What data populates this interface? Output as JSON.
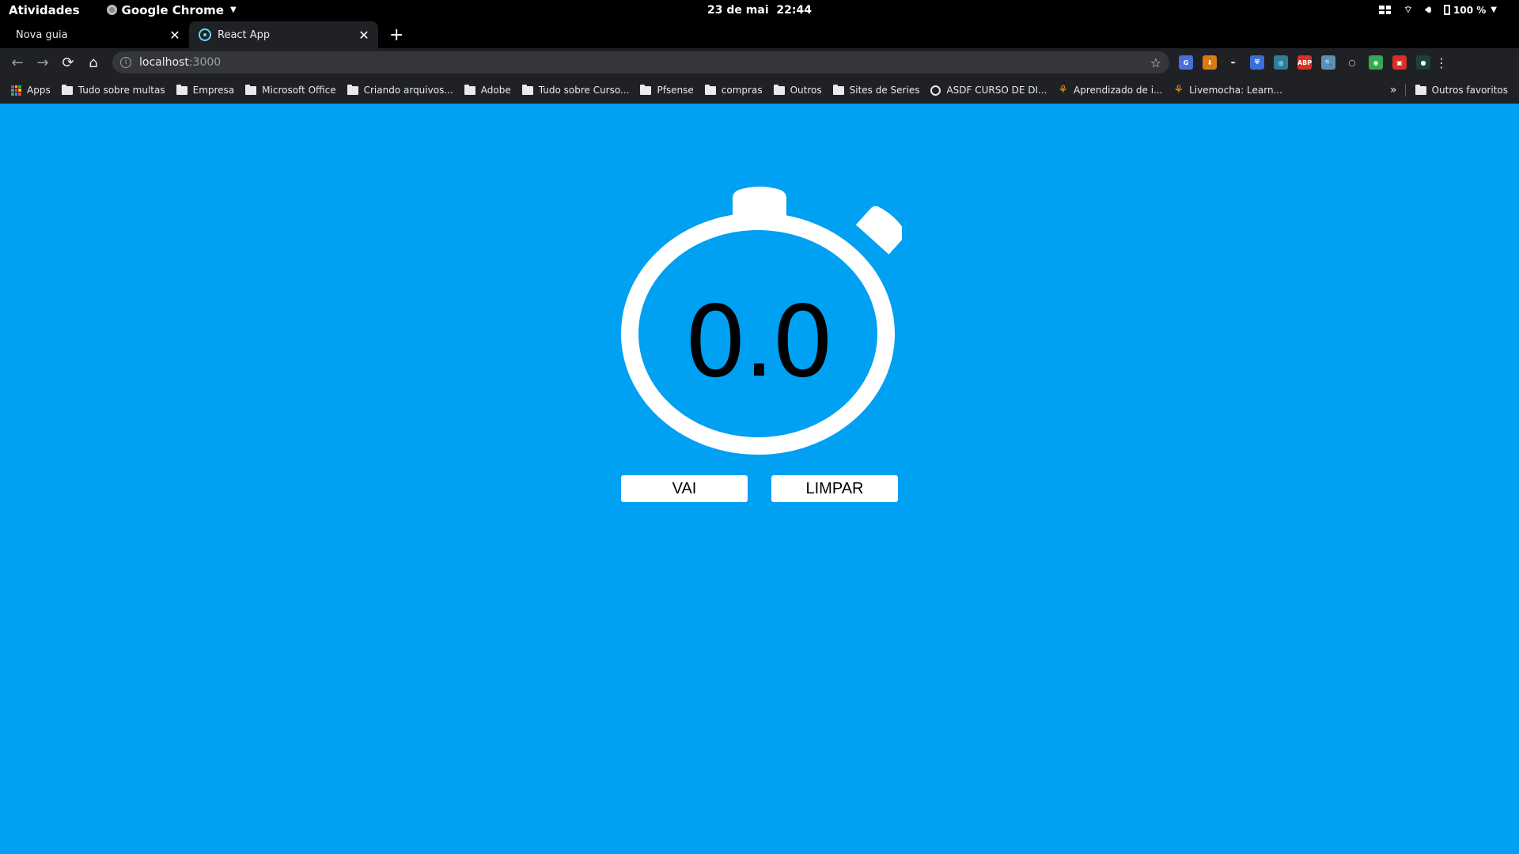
{
  "os": {
    "activities": "Atividades",
    "app_name": "Google Chrome",
    "date": "23 de mai",
    "time": "22:44",
    "battery": "100 %"
  },
  "tabs": [
    {
      "label": "Nova guia",
      "close": "✕",
      "active": false
    },
    {
      "label": "React App",
      "close": "✕",
      "active": true
    }
  ],
  "newtab_label": "+",
  "toolbar": {
    "back": "←",
    "forward": "→",
    "reload": "⟳",
    "home": "⌂",
    "url_host": "localhost",
    "url_port": ":3000",
    "star": "☆",
    "menu": "⋮"
  },
  "extensions": [
    {
      "name": "translate-extension-icon",
      "color": "#4a6ee0",
      "label": "G"
    },
    {
      "name": "download-extension-icon",
      "color": "#d97a15",
      "label": "⬇"
    },
    {
      "name": "feather-extension-icon",
      "color": "#202124",
      "label": "✒"
    },
    {
      "name": "shield-extension-icon",
      "color": "#3a6fd8",
      "label": "⛨"
    },
    {
      "name": "colorful-extension-icon",
      "color": "#2e7d9a",
      "label": "◎"
    },
    {
      "name": "adblock-extension-icon",
      "color": "#d93025",
      "label": "ABP"
    },
    {
      "name": "magnifier-extension-icon",
      "color": "#5e8fb3",
      "label": "🔍"
    },
    {
      "name": "circle-extension-icon",
      "color": "#202124",
      "label": "◯"
    },
    {
      "name": "chrome-extension-icon",
      "color": "#34a853",
      "label": "◉"
    },
    {
      "name": "red-extension-icon",
      "color": "#d93025",
      "label": "▣"
    },
    {
      "name": "profile-extension-icon",
      "color": "#1b4332",
      "label": "●"
    }
  ],
  "bookmarks": {
    "apps": "Apps",
    "items": [
      {
        "label": "Tudo sobre multas",
        "icon": "folder"
      },
      {
        "label": "Empresa",
        "icon": "folder"
      },
      {
        "label": "Microsoft Office",
        "icon": "folder"
      },
      {
        "label": "Criando arquivos...",
        "icon": "folder"
      },
      {
        "label": "Adobe",
        "icon": "folder"
      },
      {
        "label": "Tudo sobre Curso...",
        "icon": "folder"
      },
      {
        "label": "Pfsense",
        "icon": "folder"
      },
      {
        "label": "compras",
        "icon": "folder"
      },
      {
        "label": "Outros",
        "icon": "folder"
      },
      {
        "label": "Sites de Series",
        "icon": "folder"
      },
      {
        "label": "ASDF CURSO DE DI...",
        "icon": "globe"
      },
      {
        "label": "Aprendizado de i...",
        "icon": "lingo"
      },
      {
        "label": "Livemocha: Learn...",
        "icon": "lingo"
      }
    ],
    "more": "»",
    "other": "Outros favoritos"
  },
  "app": {
    "timer_value": "0.0",
    "start_label": "VAI",
    "clear_label": "LIMPAR",
    "accent": "#00a0f2"
  }
}
